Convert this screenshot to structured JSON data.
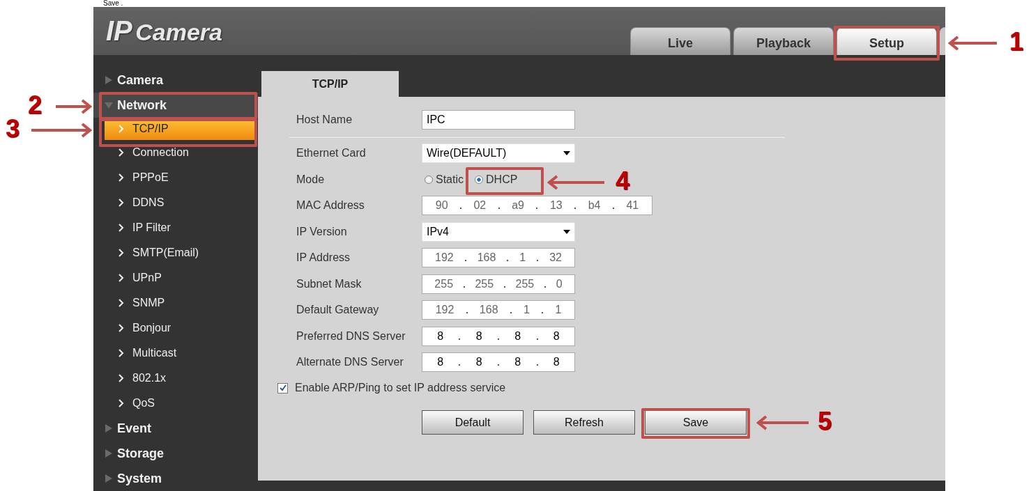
{
  "caption": "Save .",
  "logo": {
    "prefix": "IP",
    "name": "Camera"
  },
  "tabs": [
    {
      "label": "Live",
      "selected": false
    },
    {
      "label": "Playback",
      "selected": false
    },
    {
      "label": "Setup",
      "selected": true
    }
  ],
  "sidebar": {
    "items": [
      {
        "label": "Camera",
        "expanded": false
      },
      {
        "label": "Network",
        "expanded": true,
        "children": [
          {
            "label": "TCP/IP",
            "selected": true
          },
          {
            "label": "Connection",
            "selected": false
          },
          {
            "label": "PPPoE",
            "selected": false
          },
          {
            "label": "DDNS",
            "selected": false
          },
          {
            "label": "IP Filter",
            "selected": false
          },
          {
            "label": "SMTP(Email)",
            "selected": false
          },
          {
            "label": "UPnP",
            "selected": false
          },
          {
            "label": "SNMP",
            "selected": false
          },
          {
            "label": "Bonjour",
            "selected": false
          },
          {
            "label": "Multicast",
            "selected": false
          },
          {
            "label": "802.1x",
            "selected": false
          },
          {
            "label": "QoS",
            "selected": false
          }
        ]
      },
      {
        "label": "Event",
        "expanded": false
      },
      {
        "label": "Storage",
        "expanded": false
      },
      {
        "label": "System",
        "expanded": false
      }
    ]
  },
  "panel_tab": "TCP/IP",
  "fields": [
    {
      "kind": "text",
      "label": "Host Name",
      "value": "IPC"
    },
    {
      "kind": "select",
      "label": "Ethernet Card",
      "value": "Wire(DEFAULT)"
    },
    {
      "kind": "radio",
      "label": "Mode",
      "options": [
        {
          "label": "Static",
          "selected": false
        },
        {
          "label": "DHCP",
          "selected": true
        }
      ]
    },
    {
      "kind": "address",
      "label": "MAC Address",
      "values": [
        "90",
        "02",
        "a9",
        "13",
        "b4",
        "41"
      ],
      "disabled": true
    },
    {
      "kind": "select",
      "label": "IP Version",
      "value": "IPv4"
    },
    {
      "kind": "address",
      "label": "IP Address",
      "values": [
        "192",
        "168",
        "1",
        "32"
      ],
      "disabled": true
    },
    {
      "kind": "address",
      "label": "Subnet Mask",
      "values": [
        "255",
        "255",
        "255",
        "0"
      ],
      "disabled": true
    },
    {
      "kind": "address",
      "label": "Default Gateway",
      "values": [
        "192",
        "168",
        "1",
        "1"
      ],
      "disabled": true
    },
    {
      "kind": "address",
      "label": "Preferred DNS Server",
      "values": [
        "8",
        "8",
        "8",
        "8"
      ],
      "disabled": false
    },
    {
      "kind": "address",
      "label": "Alternate DNS Server",
      "values": [
        "8",
        "8",
        "8",
        "8"
      ],
      "disabled": false
    }
  ],
  "checkbox": {
    "label": "Enable ARP/Ping to set IP address service",
    "checked": true
  },
  "buttons": [
    {
      "label": "Default"
    },
    {
      "label": "Refresh"
    },
    {
      "label": "Save"
    }
  ],
  "callouts": [
    "1",
    "2",
    "3",
    "4",
    "5"
  ]
}
